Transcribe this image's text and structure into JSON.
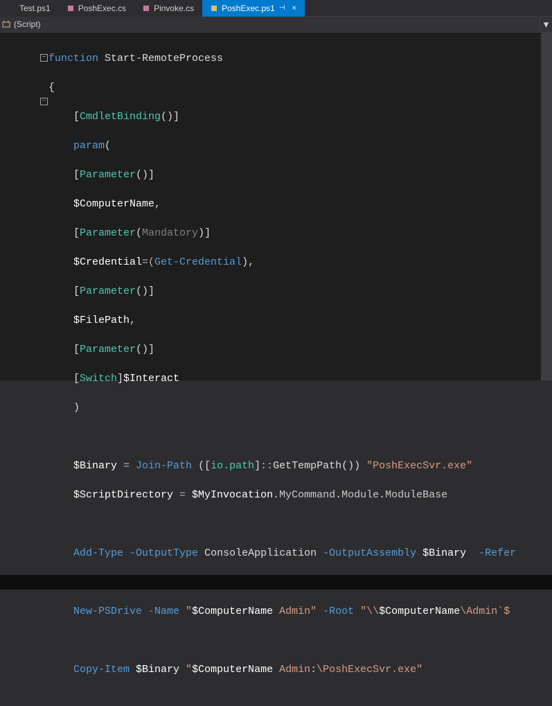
{
  "tabs": [
    {
      "label": "Test.ps1",
      "active": false,
      "icon": "ps-file-icon"
    },
    {
      "label": "PoshExec.cs",
      "active": false,
      "icon": "cs-file-icon"
    },
    {
      "label": "Pinvoke.cs",
      "active": false,
      "icon": "cs-file-icon"
    },
    {
      "label": "PoshExec.ps1",
      "active": true,
      "icon": "ps-file-icon",
      "pinned": true
    }
  ],
  "context": {
    "scope": "(Script)"
  },
  "folds": {
    "minus": "−"
  },
  "code": {
    "l1_function": "function",
    "l1_name": " Start-RemoteProcess",
    "l2_brace": "{",
    "l3_open": "    [",
    "l3_attr": "CmdletBinding",
    "l3_close": "()]",
    "l4_param": "    param",
    "l4_open": "(",
    "l5_open": "    [",
    "l5_attr": "Parameter",
    "l5_close": "()]",
    "l6_var": "    $ComputerName",
    "l6_comma": ",",
    "l7_open": "    [",
    "l7_attr": "Parameter",
    "l7_mid": "(",
    "l7_arg": "Mandatory",
    "l7_close": ")]",
    "l8_var": "    $Credential",
    "l8_eq": "=(",
    "l8_cmd": "Get-Credential",
    "l8_close": "),",
    "l9_open": "    [",
    "l9_attr": "Parameter",
    "l9_close": "()]",
    "l10_var": "    $FilePath",
    "l10_comma": ",",
    "l11_open": "    [",
    "l11_attr": "Parameter",
    "l11_close": "()]",
    "l12_open": "    [",
    "l12_attr": "Switch",
    "l12_close": "]",
    "l12_var": "$Interact",
    "l13_close": "    )",
    "l15_var": "    $Binary",
    "l15_eq": " = ",
    "l15_cmd": "Join-Path",
    "l15_open": " ([",
    "l15_type": "io.path",
    "l15_close": "]",
    "l15_op": "::",
    "l15_method": "GetTempPath()) ",
    "l15_str": "\"PoshExecSvr.exe\"",
    "l16_var": "    $ScriptDirectory",
    "l16_eq": " = ",
    "l16_var2": "$MyInvocation",
    "l16_dot": ".",
    "l16_m1": "MyCommand",
    "l16_m2": "Module",
    "l16_m3": "ModuleBase",
    "l18_cmd": "    Add-Type",
    "l18_p1": " -OutputType",
    "l18_v1": " ConsoleApplication",
    "l18_p2": " -OutputAssembly",
    "l18_v2": " $Binary",
    "l18_p3": "  -Refer",
    "l20_cmd": "    New-PSDrive",
    "l20_p1": " -Name",
    "l20_s1a": " \"",
    "l20_s1b": "$ComputerName",
    "l20_s1c": " Admin",
    "l20_s1d": "\"",
    "l20_p2": " -Root",
    "l20_s2a": " \"",
    "l20_s2b": "\\\\",
    "l20_s2c": "$ComputerName",
    "l20_s2d": "\\Admin",
    "l20_s2e": "`$",
    "l22_cmd": "    Copy-Item",
    "l22_v1": " $Binary",
    "l22_s1a": " \"",
    "l22_s1b": "$ComputerName",
    "l22_s1c": " Admin",
    "l22_s1d": ":",
    "l22_s1e": "\\PoshExecSvr.exe",
    "l22_s1f": "\""
  }
}
